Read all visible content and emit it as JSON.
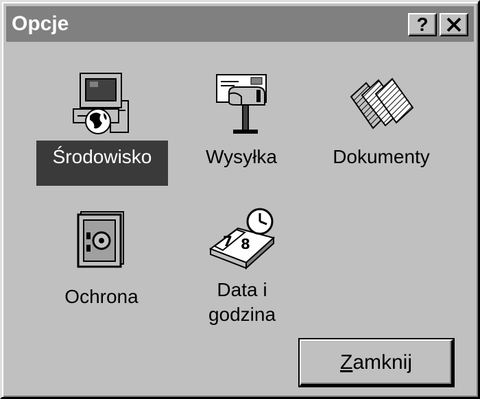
{
  "window": {
    "title": "Opcje",
    "help_label": "?",
    "close_label": "Close"
  },
  "items": [
    {
      "label": "Środowisko",
      "icon": "computer-globe-icon",
      "selected": true
    },
    {
      "label": "Wysyłka",
      "icon": "mailbox-icon",
      "selected": false
    },
    {
      "label": "Dokumenty",
      "icon": "documents-icon",
      "selected": false
    },
    {
      "label": "Ochrona",
      "icon": "safe-icon",
      "selected": false
    },
    {
      "label_line1": "Data i",
      "label_line2": "godzina",
      "icon": "calendar-clock-icon",
      "selected": false
    }
  ],
  "buttons": {
    "close_accel": "Z",
    "close_rest": "amknij"
  },
  "colors": {
    "face": "#c0c0c0",
    "titlebar": "#808080",
    "selection": "#3a3a3a"
  }
}
